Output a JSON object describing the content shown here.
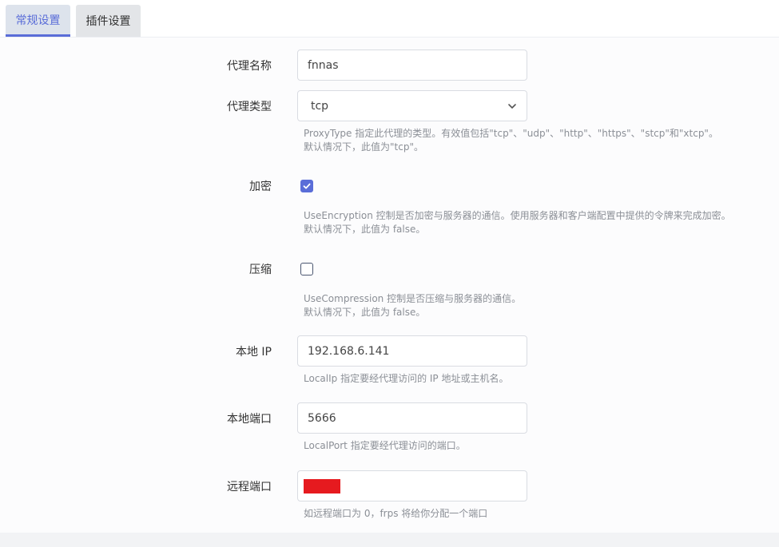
{
  "tabs": [
    {
      "label": "常规设置",
      "active": true
    },
    {
      "label": "插件设置",
      "active": false
    }
  ],
  "form": {
    "proxy_name": {
      "label": "代理名称",
      "value": "fnnas"
    },
    "proxy_type": {
      "label": "代理类型",
      "value": "tcp",
      "hint1": "ProxyType 指定此代理的类型。有效值包括\"tcp\"、\"udp\"、\"http\"、\"https\"、\"stcp\"和\"xtcp\"。",
      "hint2": "默认情况下，此值为\"tcp\"。"
    },
    "encryption": {
      "label": "加密",
      "checked": true,
      "hint1": "UseEncryption 控制是否加密与服务器的通信。使用服务器和客户端配置中提供的令牌来完成加密。",
      "hint2": "默认情况下，此值为 false。"
    },
    "compression": {
      "label": "压缩",
      "checked": false,
      "hint1": "UseCompression 控制是否压缩与服务器的通信。",
      "hint2": "默认情况下，此值为 false。"
    },
    "local_ip": {
      "label": "本地 IP",
      "value": "192.168.6.141",
      "hint": "LocalIp 指定要经代理访问的 IP 地址或主机名。"
    },
    "local_port": {
      "label": "本地端口",
      "value": "5666",
      "hint": "LocalPort 指定要经代理访问的端口。"
    },
    "remote_port": {
      "label": "远程端口",
      "value": "",
      "hint": "如远程端口为 0，frps 将给你分配一个端口"
    }
  },
  "colors": {
    "accent": "#5a6dd8",
    "redaction": "#e61a1f"
  }
}
